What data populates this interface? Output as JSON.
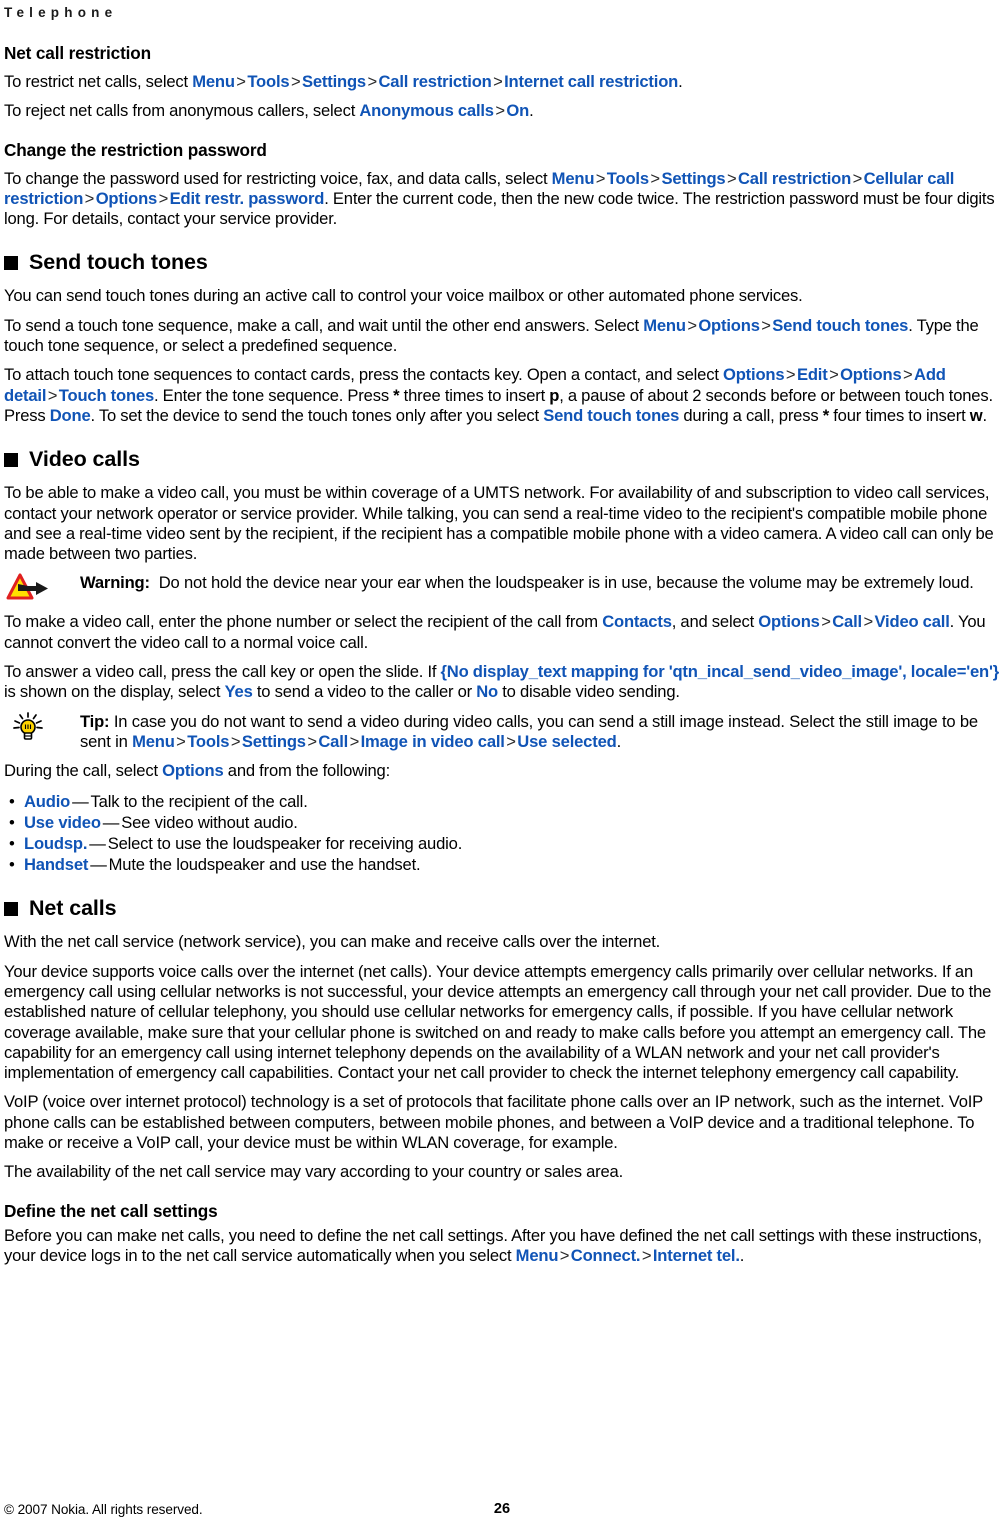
{
  "document": {
    "running_header": "Telephone",
    "footer": {
      "copyright": "© 2007 Nokia. All rights reserved.",
      "page_number": "26"
    },
    "colors": {
      "ui_term_blue": "#1054b6",
      "text_black": "#000000",
      "page_background": "#ffffff",
      "warning_icon_red": "#e02020",
      "warning_icon_yellow": "#ffe000",
      "tip_icon_yellow": "#ffd400"
    }
  },
  "sections": {
    "net_call_restriction": {
      "heading": "Net call restriction",
      "p1": {
        "lead": "To restrict net calls, select ",
        "path": [
          "Menu",
          "Tools",
          "Settings",
          "Call restriction",
          "Internet call restriction"
        ],
        "tail": "."
      },
      "p2": {
        "lead": "To reject net calls from anonymous callers, select ",
        "path": [
          "Anonymous calls",
          "On"
        ],
        "tail": "."
      }
    },
    "change_restriction_password": {
      "heading": "Change the restriction password",
      "p1": {
        "lead": "To change the password used for restricting voice, fax, and data calls, select ",
        "path": [
          "Menu",
          "Tools",
          "Settings",
          "Call restriction",
          "Cellular call restriction",
          "Options",
          "Edit restr. password"
        ],
        "tail": ". Enter the current code, then the new code twice. The restriction password must be four digits long. For details, contact your service provider."
      }
    },
    "send_touch_tones": {
      "heading": "Send touch tones",
      "p1": "You can send touch tones during an active call to control your voice mailbox or other automated phone services.",
      "p2": {
        "lead": "To send a touch tone sequence, make a call, and wait until the other end answers. Select ",
        "path": [
          "Menu",
          "Options",
          "Send touch tones"
        ],
        "tail": ". Type the touch tone sequence, or select a predefined sequence."
      },
      "p3": {
        "s1": "To attach touch tone sequences to contact cards, press the contacts key. Open a contact, and select ",
        "t1": "Options",
        "t2": "Edit",
        "t3": "Options",
        "t4": "Add detail",
        "t5": "Touch tones",
        "s2": ". Enter the tone sequence. Press ",
        "star1": "*",
        "s3": " three times to insert ",
        "p_char": "p",
        "s4": ", a pause of about 2 seconds before or between touch tones. Press ",
        "t6": "Done",
        "s5": ". To set the device to send the touch tones only after you select ",
        "t7": "Send touch tones",
        "s6": " during a call, press ",
        "star2": "*",
        "s7": " four times to insert ",
        "w_char": "w",
        "s8": "."
      }
    },
    "video_calls": {
      "heading": "Video calls",
      "p1": "To be able to make a video call, you must be within coverage of a UMTS network. For availability of and subscription to video call services, contact your network operator or service provider. While talking, you can send a real-time video to the recipient's compatible mobile phone and see a real-time video sent by the recipient, if the recipient has a compatible mobile phone with a video camera. A video call can only be made between two parties.",
      "warning": {
        "icon": "warning-triangle-arrow-icon",
        "label": "Warning:",
        "text": "Do not hold the device near your ear when the loudspeaker is in use, because the volume may be extremely loud."
      },
      "p2": {
        "s1": "To make a video call, enter the phone number or select the recipient of the call from ",
        "t1": "Contacts",
        "s2": ", and select ",
        "t2": "Options",
        "t3": "Call",
        "t4": "Video call",
        "s3": ". You cannot convert the video call to a normal voice call."
      },
      "p3": {
        "s1": "To answer a video call, press the call key or open the slide. If ",
        "t1": "{No display_text mapping for 'qtn_incal_send_video_image', locale='en'}",
        "s2": " is shown on the display, select ",
        "t2": "Yes",
        "s3": " to send a video to the caller or ",
        "t3": "No",
        "s4": " to disable video sending."
      },
      "tip": {
        "icon": "tip-lightbulb-icon",
        "label": "Tip:",
        "s1": " In case you do not want to send a video during video calls, you can send a still image instead. Select the still image to be sent in ",
        "path": [
          "Menu",
          "Tools",
          "Settings",
          "Call",
          "Image in video call",
          "Use selected"
        ],
        "s2": "."
      },
      "options_intro": {
        "s1": "During the call, select ",
        "t1": "Options",
        "s2": " and from the following:"
      },
      "options_list": [
        {
          "term": "Audio",
          "desc": "Talk to the recipient of the call."
        },
        {
          "term": "Use video",
          "desc": "See video without audio."
        },
        {
          "term": "Loudsp.",
          "desc": "Select to use the loudspeaker for receiving audio."
        },
        {
          "term": "Handset",
          "desc": "Mute the loudspeaker and use the handset."
        }
      ],
      "bullet_glyph": "•",
      "dash_glyph": "—"
    },
    "net_calls": {
      "heading": "Net calls",
      "p1": "With the net call service (network service), you can make and receive calls over the internet.",
      "p2": "Your device supports voice calls over the internet (net calls). Your device attempts emergency calls primarily over cellular networks. If an emergency call using cellular networks is not successful, your device attempts an emergency call through your net call provider. Due to the established nature of cellular telephony, you should use cellular networks for emergency calls, if possible. If you have cellular network coverage available, make sure that your cellular phone is switched on and ready to make calls before you attempt an emergency call. The capability for an emergency call using internet telephony depends on the availability of a WLAN network and your net call provider's implementation of emergency call capabilities. Contact your net call provider to check the internet telephony emergency call capability.",
      "p3": "VoIP (voice over internet protocol) technology is a set of protocols that facilitate phone calls over an IP network, such as the internet. VoIP phone calls can be established between computers, between mobile phones, and between a VoIP device and a traditional telephone. To make or receive a VoIP call, your device must be within WLAN coverage, for example.",
      "p4": "The availability of the net call service may vary according to your country or sales area."
    },
    "define_net_call_settings": {
      "heading": "Define the net call settings",
      "p1": {
        "s1": "Before you can make net calls, you need to define the net call settings. After you have defined the net call settings with these instructions, your device logs in to the net call service automatically when you select ",
        "path": [
          "Menu",
          "Connect.",
          "Internet tel."
        ],
        "s2": "."
      }
    }
  }
}
